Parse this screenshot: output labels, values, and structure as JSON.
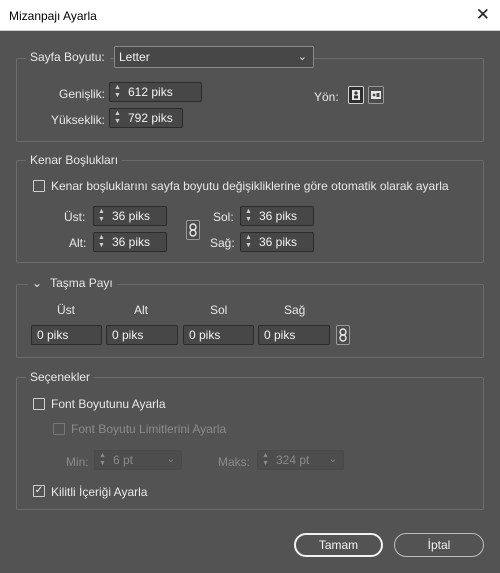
{
  "window": {
    "title": "Mizanpajı Ayarla",
    "close_glyph": "✕"
  },
  "page_size": {
    "label": "Sayfa Boyutu:",
    "value": "Letter",
    "width_label": "Genişlik:",
    "width_value": "612 piks",
    "height_label": "Yükseklik:",
    "height_value": "792 piks",
    "orientation_label": "Yön:"
  },
  "margins": {
    "legend": "Kenar Boşlukları",
    "auto_adjust_label": "Kenar boşluklarını sayfa boyutu değişikliklerine göre otomatik olarak ayarla",
    "auto_adjust_checked": false,
    "top_label": "Üst:",
    "top_value": "36 piks",
    "bottom_label": "Alt:",
    "bottom_value": "36 piks",
    "left_label": "Sol:",
    "left_value": "36 piks",
    "right_label": "Sağ:",
    "right_value": "36 piks"
  },
  "bleed": {
    "legend": "Taşma Payı",
    "collapse_glyph": "⌄",
    "col_top": "Üst",
    "col_bottom": "Alt",
    "col_left": "Sol",
    "col_right": "Sağ",
    "top_value": "0 piks",
    "bottom_value": "0 piks",
    "left_value": "0 piks",
    "right_value": "0 piks"
  },
  "options": {
    "legend": "Seçenekler",
    "font_adjust_label": "Font Boyutunu Ayarla",
    "font_adjust_checked": false,
    "font_limits_label": "Font Boyutu Limitlerini Ayarla",
    "font_limits_checked": false,
    "min_label": "Min:",
    "min_value": "6 pt",
    "max_label": "Maks:",
    "max_value": "324 pt",
    "locked_label": "Kilitli İçeriği Ayarla",
    "locked_checked": true
  },
  "buttons": {
    "ok": "Tamam",
    "cancel": "İptal"
  },
  "glyphs": {
    "check": "✓",
    "chevron_down": "⌄",
    "spin_up": "▲",
    "spin_down": "▼"
  },
  "colors": {
    "background": "#535353",
    "field": "#474747",
    "text": "#e8e8e8"
  }
}
